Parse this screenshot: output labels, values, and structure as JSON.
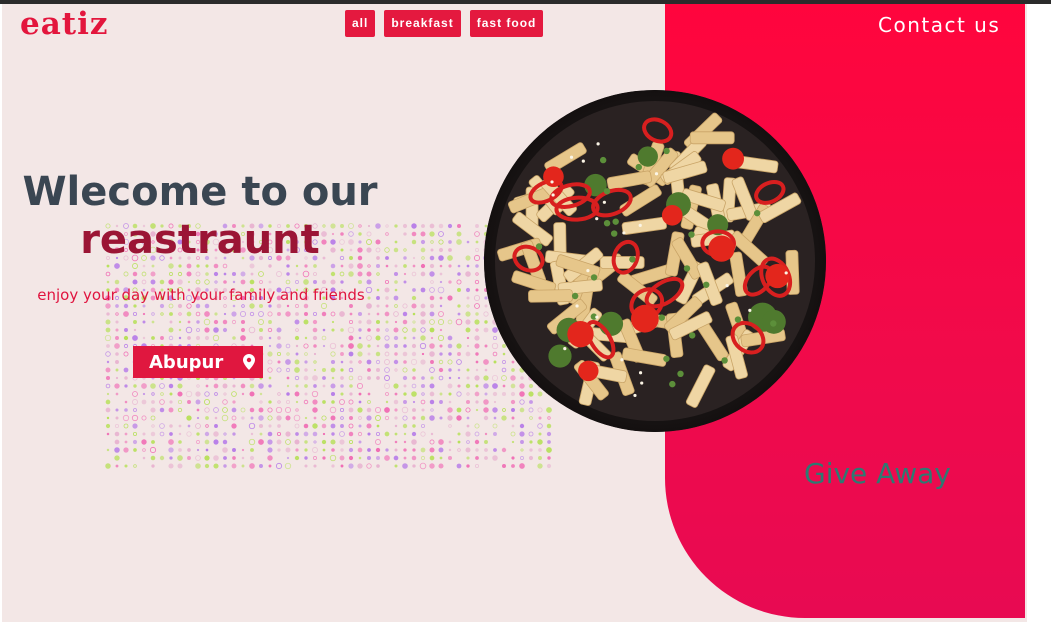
{
  "brand": {
    "logo": "eatiz"
  },
  "nav": {
    "items": [
      {
        "label": "all"
      },
      {
        "label": "breakfast"
      },
      {
        "label": "fast food"
      }
    ],
    "contact_label": "Contact us"
  },
  "hero": {
    "title_line1": "Wlecome to our",
    "title_line2": "reastraunt",
    "tagline": "enjoy your day with your family and friends",
    "location_label": "Abupur",
    "location_icon": "map-pin-icon"
  },
  "promo": {
    "label": "Give Away"
  },
  "colors": {
    "accent": "#e4193f",
    "panel_top": "#ff053d",
    "panel_bottom": "#e80a52",
    "background": "#f3e7e6",
    "title_dark": "#3a4652",
    "title_red": "#9b1535",
    "giveaway": "#2e7a72"
  },
  "images": {
    "dish": "pasta-dish-image"
  }
}
